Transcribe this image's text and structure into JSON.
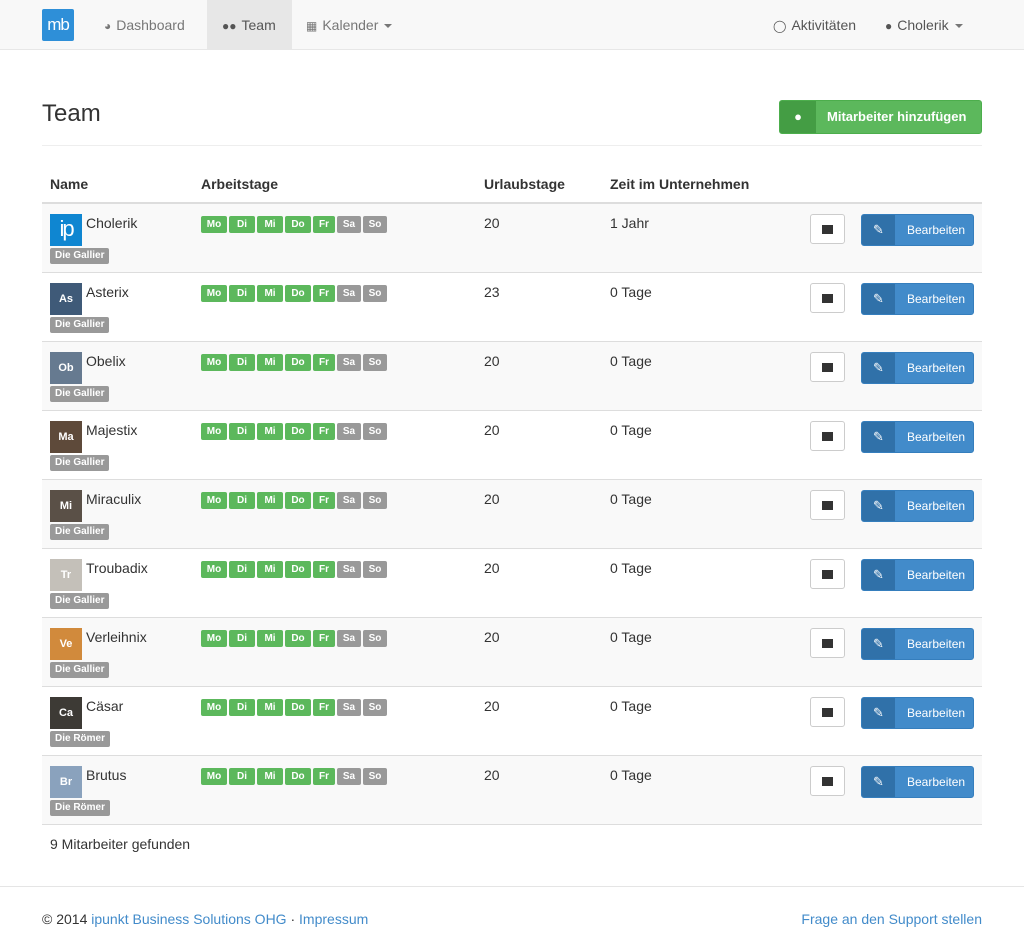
{
  "nav": {
    "brand": "mb",
    "items": [
      {
        "label": "Dashboard",
        "icon": "dashboard-icon"
      },
      {
        "label": "Team",
        "icon": "users-icon"
      },
      {
        "label": "Kalender",
        "icon": "calendar-icon"
      }
    ],
    "activities": "Aktivitäten",
    "user": "Cholerik"
  },
  "page": {
    "title": "Team",
    "add_button": "Mitarbeiter hinzufügen"
  },
  "table": {
    "headers": [
      "Name",
      "Arbeitstage",
      "Urlaubstage",
      "Zeit im Unternehmen"
    ],
    "day_labels": [
      "Mo",
      "Di",
      "Mi",
      "Do",
      "Fr",
      "Sa",
      "So"
    ],
    "edit_label": "Bearbeiten",
    "rows": [
      {
        "initials": "ip",
        "avatar_color": "#0f86d1",
        "name": "Cholerik",
        "group": "Die Gallier",
        "vacation_days": "20",
        "time": "1 Jahr",
        "workdays": [
          true,
          true,
          true,
          true,
          true,
          false,
          false
        ]
      },
      {
        "initials": "As",
        "avatar_color": "#3f5a78",
        "name": "Asterix",
        "group": "Die Gallier",
        "vacation_days": "23",
        "time": "0 Tage",
        "workdays": [
          true,
          true,
          true,
          true,
          true,
          false,
          false
        ]
      },
      {
        "initials": "Ob",
        "avatar_color": "#667a90",
        "name": "Obelix",
        "group": "Die Gallier",
        "vacation_days": "20",
        "time": "0 Tage",
        "workdays": [
          true,
          true,
          true,
          true,
          true,
          false,
          false
        ]
      },
      {
        "initials": "Ma",
        "avatar_color": "#5e4a3a",
        "name": "Majestix",
        "group": "Die Gallier",
        "vacation_days": "20",
        "time": "0 Tage",
        "workdays": [
          true,
          true,
          true,
          true,
          true,
          false,
          false
        ]
      },
      {
        "initials": "Mi",
        "avatar_color": "#5a5047",
        "name": "Miraculix",
        "group": "Die Gallier",
        "vacation_days": "20",
        "time": "0 Tage",
        "workdays": [
          true,
          true,
          true,
          true,
          true,
          false,
          false
        ]
      },
      {
        "initials": "Tr",
        "avatar_color": "#c4c0b9",
        "name": "Troubadix",
        "group": "Die Gallier",
        "vacation_days": "20",
        "time": "0 Tage",
        "workdays": [
          true,
          true,
          true,
          true,
          true,
          false,
          false
        ]
      },
      {
        "initials": "Ve",
        "avatar_color": "#d18a3c",
        "name": "Verleihnix",
        "group": "Die Gallier",
        "vacation_days": "20",
        "time": "0 Tage",
        "workdays": [
          true,
          true,
          true,
          true,
          true,
          false,
          false
        ]
      },
      {
        "initials": "Ca",
        "avatar_color": "#3d3a35",
        "name": "Cäsar",
        "group": "Die Römer",
        "vacation_days": "20",
        "time": "0 Tage",
        "workdays": [
          true,
          true,
          true,
          true,
          true,
          false,
          false
        ]
      },
      {
        "initials": "Br",
        "avatar_color": "#8aa2bd",
        "name": "Brutus",
        "group": "Die Römer",
        "vacation_days": "20",
        "time": "0 Tage",
        "workdays": [
          true,
          true,
          true,
          true,
          true,
          false,
          false
        ]
      }
    ]
  },
  "summary": "9 Mitarbeiter gefunden",
  "footer": {
    "copyright": "© 2014",
    "company_link": "ipunkt Business Solutions OHG",
    "separator": "·",
    "imprint_link": "Impressum",
    "support_link": "Frage an den Support stellen"
  },
  "colors": {
    "primary": "#428bca",
    "success": "#5cb85c",
    "muted": "#999999"
  }
}
